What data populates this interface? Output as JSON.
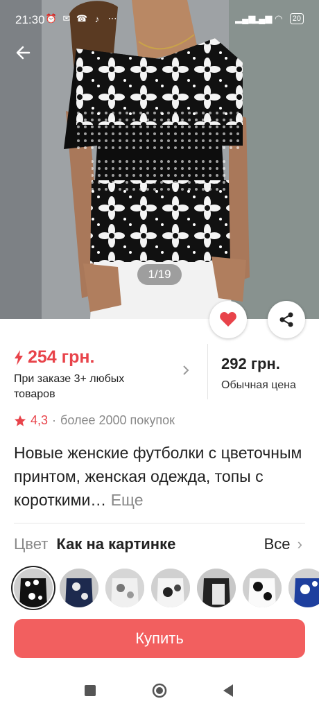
{
  "status_bar": {
    "time": "21:30",
    "battery": "20"
  },
  "gallery": {
    "counter": "1/19"
  },
  "price": {
    "promo_price": "254 грн.",
    "promo_note": "При заказе 3+ любых товаров",
    "regular_price": "292 грн.",
    "regular_note": "Обычная цена"
  },
  "rating": {
    "value": "4,3",
    "separator": "·",
    "buyers": "более 2000 покупок"
  },
  "product": {
    "title": "Новые женские футболки с цветочным принтом, женская одежда, топы с короткими…",
    "more": "Еще"
  },
  "color": {
    "label": "Цвет",
    "value": "Как на картинке",
    "all": "Все",
    "all_chevron": "›"
  },
  "actions": {
    "buy": "Купить"
  },
  "colors": {
    "accent": "#e8434a",
    "button": "#f25f5f"
  },
  "icons": [
    "back-arrow-icon",
    "heart-icon",
    "share-icon",
    "lightning-icon",
    "star-icon",
    "chevron-right-icon"
  ]
}
